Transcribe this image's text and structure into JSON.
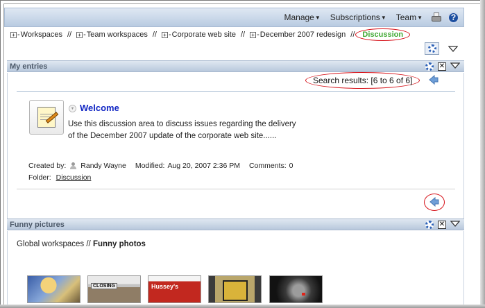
{
  "topbar": {
    "menus": [
      {
        "label": "Manage"
      },
      {
        "label": "Subscriptions"
      },
      {
        "label": "Team"
      }
    ],
    "print_icon": "printer-icon",
    "help_icon": "help-icon",
    "help_glyph": "?"
  },
  "breadcrumb": {
    "items": [
      {
        "label": "Workspaces"
      },
      {
        "label": "Team workspaces"
      },
      {
        "label": "Corporate web site"
      },
      {
        "label": "December 2007 redesign"
      }
    ],
    "separator": "//",
    "current": "Discussion"
  },
  "panels": {
    "my_entries": {
      "title": "My entries",
      "search_results": "Search results: [6 to 6 of 6]",
      "entry": {
        "title": "Welcome",
        "description": "Use this discussion area to discuss issues regarding the delivery of the December 2007 update of the corporate web site......",
        "created_by_label": "Created by:",
        "created_by": "Randy Wayne",
        "modified_label": "Modified:",
        "modified": "Aug 20, 2007 2:36 PM",
        "comments_label": "Comments:",
        "comments": "0",
        "folder_label": "Folder:",
        "folder": "Discussion"
      }
    },
    "funny_pictures": {
      "title": "Funny pictures",
      "path_prefix": "Global workspaces // ",
      "path_current": "Funny photos",
      "thumbnails": [
        {
          "name": "photo-1"
        },
        {
          "name": "photo-2",
          "caption": "CLOSING"
        },
        {
          "name": "photo-3",
          "caption": "Hussey's"
        },
        {
          "name": "photo-4"
        },
        {
          "name": "photo-5"
        }
      ]
    }
  },
  "colors": {
    "accent_green": "#3fa832",
    "annotation_red": "#d6131a",
    "link_blue": "#1227c4",
    "header_blue": "#b8c8dc"
  }
}
